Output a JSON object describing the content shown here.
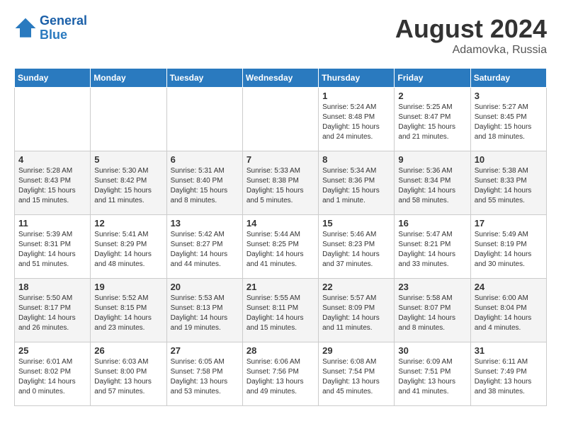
{
  "header": {
    "logo_line1": "General",
    "logo_line2": "Blue",
    "month_year": "August 2024",
    "location": "Adamovka, Russia"
  },
  "weekdays": [
    "Sunday",
    "Monday",
    "Tuesday",
    "Wednesday",
    "Thursday",
    "Friday",
    "Saturday"
  ],
  "weeks": [
    [
      {
        "day": "",
        "info": ""
      },
      {
        "day": "",
        "info": ""
      },
      {
        "day": "",
        "info": ""
      },
      {
        "day": "",
        "info": ""
      },
      {
        "day": "1",
        "info": "Sunrise: 5:24 AM\nSunset: 8:48 PM\nDaylight: 15 hours\nand 24 minutes."
      },
      {
        "day": "2",
        "info": "Sunrise: 5:25 AM\nSunset: 8:47 PM\nDaylight: 15 hours\nand 21 minutes."
      },
      {
        "day": "3",
        "info": "Sunrise: 5:27 AM\nSunset: 8:45 PM\nDaylight: 15 hours\nand 18 minutes."
      }
    ],
    [
      {
        "day": "4",
        "info": "Sunrise: 5:28 AM\nSunset: 8:43 PM\nDaylight: 15 hours\nand 15 minutes."
      },
      {
        "day": "5",
        "info": "Sunrise: 5:30 AM\nSunset: 8:42 PM\nDaylight: 15 hours\nand 11 minutes."
      },
      {
        "day": "6",
        "info": "Sunrise: 5:31 AM\nSunset: 8:40 PM\nDaylight: 15 hours\nand 8 minutes."
      },
      {
        "day": "7",
        "info": "Sunrise: 5:33 AM\nSunset: 8:38 PM\nDaylight: 15 hours\nand 5 minutes."
      },
      {
        "day": "8",
        "info": "Sunrise: 5:34 AM\nSunset: 8:36 PM\nDaylight: 15 hours\nand 1 minute."
      },
      {
        "day": "9",
        "info": "Sunrise: 5:36 AM\nSunset: 8:34 PM\nDaylight: 14 hours\nand 58 minutes."
      },
      {
        "day": "10",
        "info": "Sunrise: 5:38 AM\nSunset: 8:33 PM\nDaylight: 14 hours\nand 55 minutes."
      }
    ],
    [
      {
        "day": "11",
        "info": "Sunrise: 5:39 AM\nSunset: 8:31 PM\nDaylight: 14 hours\nand 51 minutes."
      },
      {
        "day": "12",
        "info": "Sunrise: 5:41 AM\nSunset: 8:29 PM\nDaylight: 14 hours\nand 48 minutes."
      },
      {
        "day": "13",
        "info": "Sunrise: 5:42 AM\nSunset: 8:27 PM\nDaylight: 14 hours\nand 44 minutes."
      },
      {
        "day": "14",
        "info": "Sunrise: 5:44 AM\nSunset: 8:25 PM\nDaylight: 14 hours\nand 41 minutes."
      },
      {
        "day": "15",
        "info": "Sunrise: 5:46 AM\nSunset: 8:23 PM\nDaylight: 14 hours\nand 37 minutes."
      },
      {
        "day": "16",
        "info": "Sunrise: 5:47 AM\nSunset: 8:21 PM\nDaylight: 14 hours\nand 33 minutes."
      },
      {
        "day": "17",
        "info": "Sunrise: 5:49 AM\nSunset: 8:19 PM\nDaylight: 14 hours\nand 30 minutes."
      }
    ],
    [
      {
        "day": "18",
        "info": "Sunrise: 5:50 AM\nSunset: 8:17 PM\nDaylight: 14 hours\nand 26 minutes."
      },
      {
        "day": "19",
        "info": "Sunrise: 5:52 AM\nSunset: 8:15 PM\nDaylight: 14 hours\nand 23 minutes."
      },
      {
        "day": "20",
        "info": "Sunrise: 5:53 AM\nSunset: 8:13 PM\nDaylight: 14 hours\nand 19 minutes."
      },
      {
        "day": "21",
        "info": "Sunrise: 5:55 AM\nSunset: 8:11 PM\nDaylight: 14 hours\nand 15 minutes."
      },
      {
        "day": "22",
        "info": "Sunrise: 5:57 AM\nSunset: 8:09 PM\nDaylight: 14 hours\nand 11 minutes."
      },
      {
        "day": "23",
        "info": "Sunrise: 5:58 AM\nSunset: 8:07 PM\nDaylight: 14 hours\nand 8 minutes."
      },
      {
        "day": "24",
        "info": "Sunrise: 6:00 AM\nSunset: 8:04 PM\nDaylight: 14 hours\nand 4 minutes."
      }
    ],
    [
      {
        "day": "25",
        "info": "Sunrise: 6:01 AM\nSunset: 8:02 PM\nDaylight: 14 hours\nand 0 minutes."
      },
      {
        "day": "26",
        "info": "Sunrise: 6:03 AM\nSunset: 8:00 PM\nDaylight: 13 hours\nand 57 minutes."
      },
      {
        "day": "27",
        "info": "Sunrise: 6:05 AM\nSunset: 7:58 PM\nDaylight: 13 hours\nand 53 minutes."
      },
      {
        "day": "28",
        "info": "Sunrise: 6:06 AM\nSunset: 7:56 PM\nDaylight: 13 hours\nand 49 minutes."
      },
      {
        "day": "29",
        "info": "Sunrise: 6:08 AM\nSunset: 7:54 PM\nDaylight: 13 hours\nand 45 minutes."
      },
      {
        "day": "30",
        "info": "Sunrise: 6:09 AM\nSunset: 7:51 PM\nDaylight: 13 hours\nand 41 minutes."
      },
      {
        "day": "31",
        "info": "Sunrise: 6:11 AM\nSunset: 7:49 PM\nDaylight: 13 hours\nand 38 minutes."
      }
    ]
  ]
}
